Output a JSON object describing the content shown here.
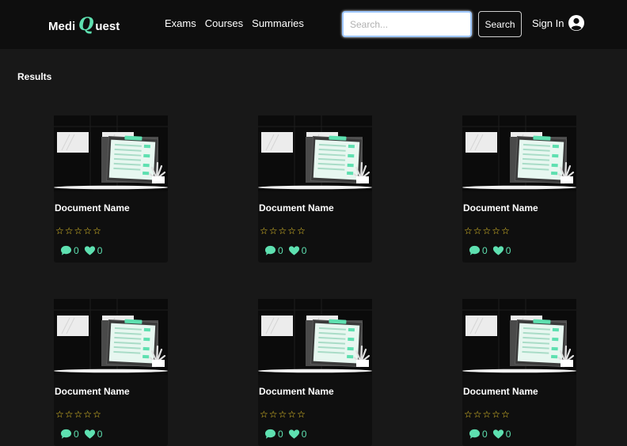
{
  "brand": {
    "left": "Medi",
    "q": "Q",
    "right": "uest"
  },
  "nav": {
    "links": [
      "Exams",
      "Courses",
      "Summaries"
    ]
  },
  "search": {
    "placeholder": "Search...",
    "button_label": "Search"
  },
  "auth": {
    "signin_label": "Sign In"
  },
  "results": {
    "title": "Results",
    "cards": [
      {
        "name": "Document Name",
        "rating": 0,
        "comments": "0",
        "likes": "0"
      },
      {
        "name": "Document Name",
        "rating": 0,
        "comments": "0",
        "likes": "0"
      },
      {
        "name": "Document Name",
        "rating": 0,
        "comments": "0",
        "likes": "0"
      },
      {
        "name": "Document Name",
        "rating": 0,
        "comments": "0",
        "likes": "0"
      },
      {
        "name": "Document Name",
        "rating": 0,
        "comments": "0",
        "likes": "0"
      },
      {
        "name": "Document Name",
        "rating": 0,
        "comments": "0",
        "likes": "0"
      }
    ]
  },
  "icons": {
    "user": "user-circle-icon",
    "comment": "comment-icon",
    "like": "heart-icon",
    "star": "star-outline-icon"
  },
  "colors": {
    "accent": "#5ee0b0",
    "star": "#f2d02b",
    "background": "#181818",
    "navbar": "#0e0e0e"
  }
}
